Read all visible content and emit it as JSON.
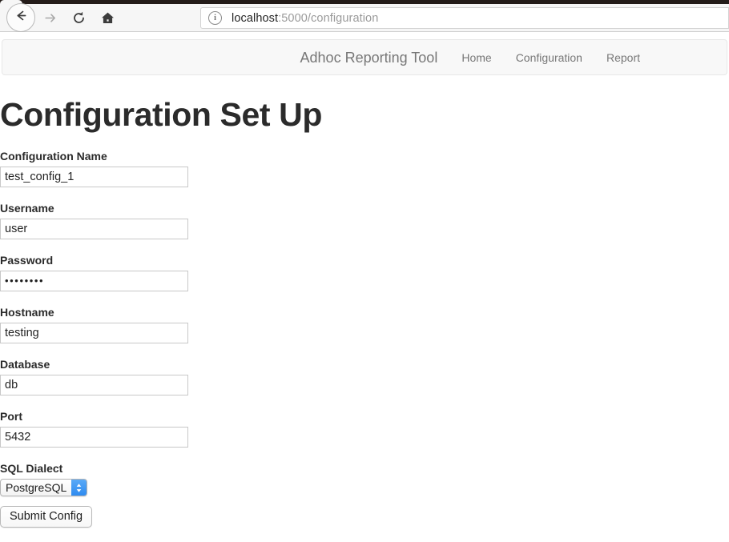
{
  "browser": {
    "back_icon": "arrow-left-icon",
    "forward_icon": "arrow-right-icon",
    "reload_icon": "reload-icon",
    "home_icon": "home-icon",
    "security_icon": "info-circle-icon",
    "url_host": "localhost",
    "url_path": ":5000/configuration",
    "url_full": "localhost:5000/configuration"
  },
  "navbar": {
    "brand": "Adhoc Reporting Tool",
    "links": [
      {
        "label": "Home"
      },
      {
        "label": "Configuration"
      },
      {
        "label": "Report"
      }
    ]
  },
  "page": {
    "title": "Configuration Set Up"
  },
  "form": {
    "fields": [
      {
        "label": "Configuration Name",
        "value": "test_config_1",
        "type": "text"
      },
      {
        "label": "Username",
        "value": "user",
        "type": "text"
      },
      {
        "label": "Password",
        "value": "••••••••",
        "type": "password"
      },
      {
        "label": "Hostname",
        "value": "testing",
        "type": "text"
      },
      {
        "label": "Database",
        "value": "db",
        "type": "text"
      },
      {
        "label": "Port",
        "value": "5432",
        "type": "text"
      }
    ],
    "dialect": {
      "label": "SQL Dialect",
      "selected": "PostgreSQL",
      "stepper_icon": "updown-chevron-icon"
    },
    "submit": {
      "label": "Submit Config"
    }
  },
  "colors": {
    "navbar_bg": "#f8f8f8",
    "navbar_text": "#777777",
    "title_text": "#2b2b2b",
    "input_border": "#c8c8c8",
    "stepper_blue": "#3b99fc",
    "chrome_bg": "#f6f6f6",
    "tabstrip_dark": "#241c19"
  }
}
